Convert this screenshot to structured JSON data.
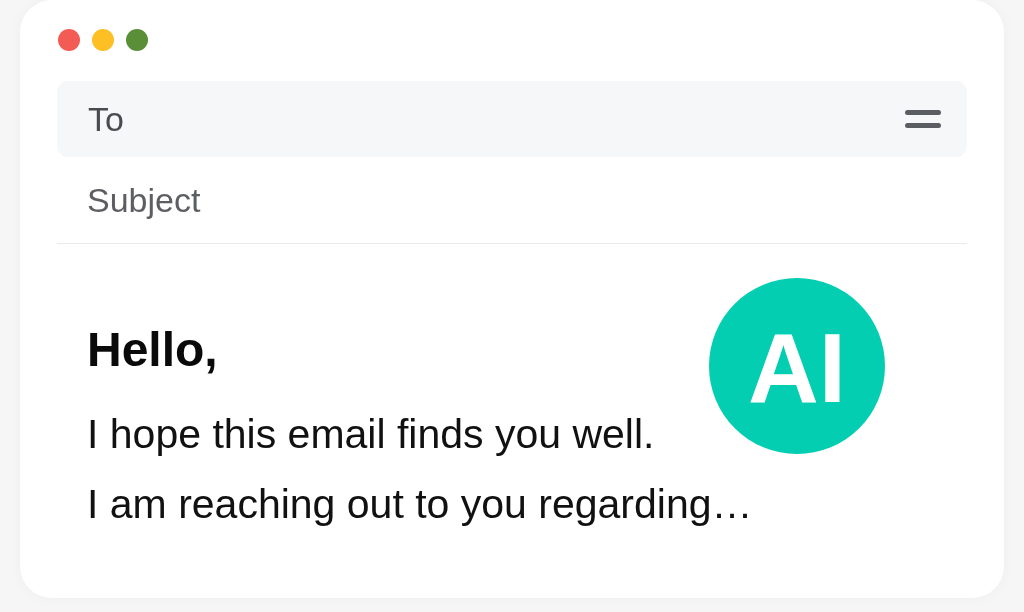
{
  "window": {
    "controls": [
      {
        "color": "#f25c54"
      },
      {
        "color": "#fdbf24"
      },
      {
        "color": "#5a8f37"
      }
    ]
  },
  "to_field": {
    "placeholder": "To"
  },
  "subject_field": {
    "placeholder": "Subject"
  },
  "body": {
    "greeting": "Hello,",
    "lines": [
      "I hope this email finds you well.",
      "I am reaching out to you regarding…"
    ]
  },
  "ai_badge": {
    "text": "AI"
  }
}
